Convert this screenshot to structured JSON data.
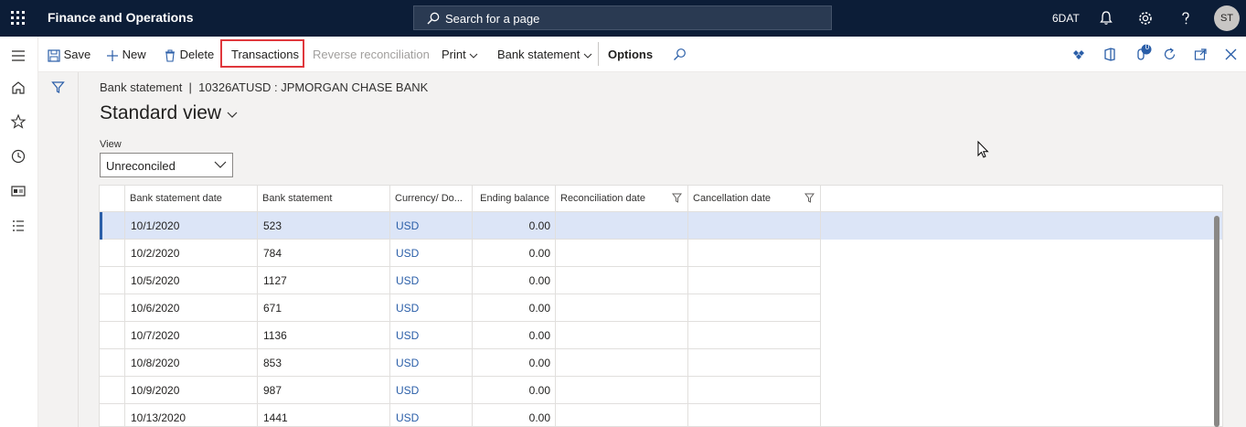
{
  "topbar": {
    "app_title": "Finance and Operations",
    "search_placeholder": "Search for a page",
    "company": "6DAT",
    "avatar_initials": "ST"
  },
  "actions": {
    "save": "Save",
    "new": "New",
    "delete": "Delete",
    "transactions": "Transactions",
    "reverse_reconciliation": "Reverse reconciliation",
    "print": "Print",
    "bank_statement": "Bank statement",
    "options": "Options",
    "badge_count": "0"
  },
  "page": {
    "breadcrumb": "Bank statement  |  10326ATUSD : JPMORGAN CHASE BANK",
    "title": "Standard view",
    "view_label": "View",
    "view_value": "Unreconciled"
  },
  "grid": {
    "columns": [
      "Bank statement date",
      "Bank statement",
      "Currency/ Do...",
      "Ending balance",
      "Reconciliation date",
      "Cancellation date"
    ],
    "rows": [
      {
        "date": "10/1/2020",
        "statement": "523",
        "currency": "USD",
        "balance": "0.00"
      },
      {
        "date": "10/2/2020",
        "statement": "784",
        "currency": "USD",
        "balance": "0.00"
      },
      {
        "date": "10/5/2020",
        "statement": "1127",
        "currency": "USD",
        "balance": "0.00"
      },
      {
        "date": "10/6/2020",
        "statement": "671",
        "currency": "USD",
        "balance": "0.00"
      },
      {
        "date": "10/7/2020",
        "statement": "1136",
        "currency": "USD",
        "balance": "0.00"
      },
      {
        "date": "10/8/2020",
        "statement": "853",
        "currency": "USD",
        "balance": "0.00"
      },
      {
        "date": "10/9/2020",
        "statement": "987",
        "currency": "USD",
        "balance": "0.00"
      },
      {
        "date": "10/13/2020",
        "statement": "1441",
        "currency": "USD",
        "balance": "0.00"
      }
    ]
  },
  "colors": {
    "topbar": "#0c1d37",
    "accent": "#2a5ea8",
    "selected_row": "#dce5f7",
    "highlight_box": "#e0373c"
  }
}
